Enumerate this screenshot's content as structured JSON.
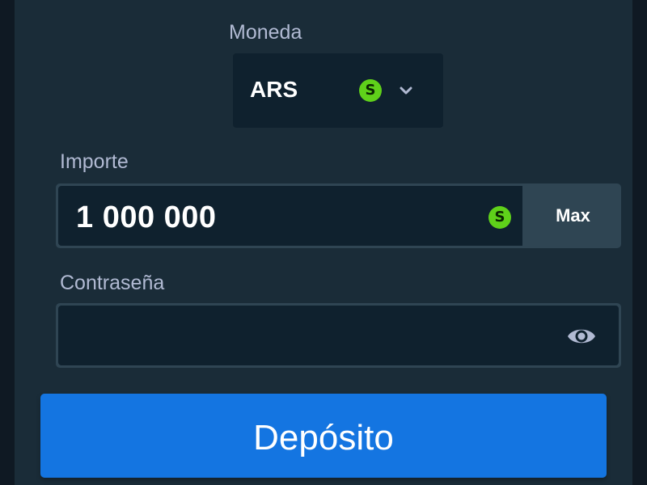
{
  "currency": {
    "label": "Moneda",
    "selected": "ARS",
    "coin_symbol": "S"
  },
  "amount": {
    "label": "Importe",
    "value": "1 000 000",
    "coin_symbol": "S",
    "max_label": "Max"
  },
  "password": {
    "label": "Contraseña",
    "value": ""
  },
  "deposit_label": "Depósito",
  "colors": {
    "background": "#0f1923",
    "panel": "#1a2c38",
    "field": "#0f212e",
    "border": "#2f4553",
    "accent": "#1475e1",
    "coin": "#5fd11a"
  }
}
